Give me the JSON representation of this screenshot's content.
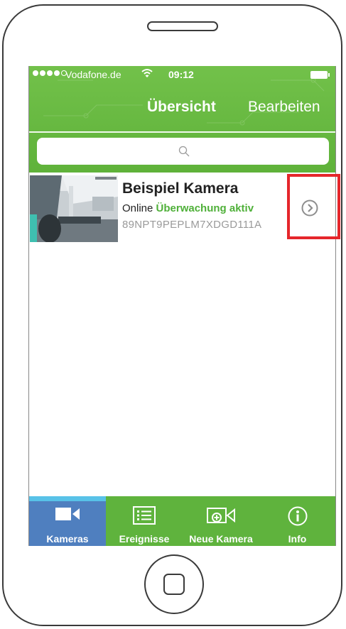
{
  "status_bar": {
    "carrier": "Vodafone.de",
    "time": "09:12"
  },
  "nav": {
    "title": "Übersicht",
    "edit_label": "Bearbeiten"
  },
  "search": {
    "icon": "search-icon"
  },
  "camera": {
    "name": "Beispiel Kamera",
    "online_label": "Online",
    "monitoring_label": "Überwachung aktiv",
    "id": "89NPT9PEPLM7XDGD111A",
    "detail_icon": "chevron-right-circle-icon"
  },
  "tabs": [
    {
      "label": "Kameras",
      "icon": "video-camera-icon",
      "active": true
    },
    {
      "label": "Ereignisse",
      "icon": "list-icon",
      "active": false
    },
    {
      "label": "Neue Kamera",
      "icon": "add-camera-icon",
      "active": false
    },
    {
      "label": "Info",
      "icon": "info-icon",
      "active": false
    }
  ],
  "colors": {
    "header_green": "#5fb23a",
    "accent_green": "#4fb039",
    "active_tab": "#4f7fbf",
    "highlight_red": "#e5262b"
  }
}
